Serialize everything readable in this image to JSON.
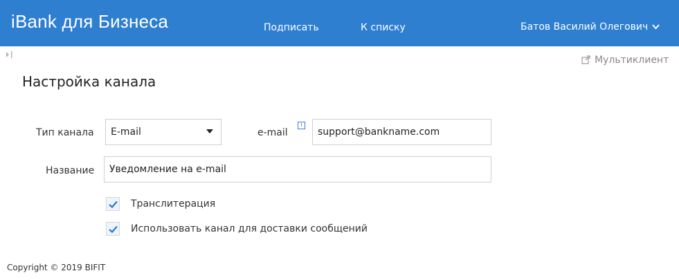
{
  "header": {
    "brand": "iBank для Бизнеса",
    "nav": {
      "sign": "Подписать",
      "to_list": "К списку"
    },
    "user_name": "Батов Василий Олегович",
    "user_chevron_icon": "chevron-down-icon",
    "background": "#2f7fd1"
  },
  "toolbar": {
    "multiclient_label": "Мультиклиент",
    "multiclient_icon": "external-link-icon"
  },
  "page": {
    "title": "Настройка канала"
  },
  "form": {
    "channel_type": {
      "label": "Тип канала",
      "value": "E-mail"
    },
    "email": {
      "label": "e-mail",
      "info_icon_text": "i",
      "value": "support@bankname.com"
    },
    "name": {
      "label": "Название",
      "value": "Уведомление на e-mail"
    },
    "transliteration": {
      "label": "Транслитерация",
      "checked": true
    },
    "use_channel": {
      "label": "Использовать канал для доставки сообщений",
      "checked": true
    }
  },
  "footer": {
    "copyright": "Copyright © 2019 BIFIT"
  },
  "colors": {
    "accent": "#2f7fd1",
    "checkmark": "#2f7fd1"
  }
}
